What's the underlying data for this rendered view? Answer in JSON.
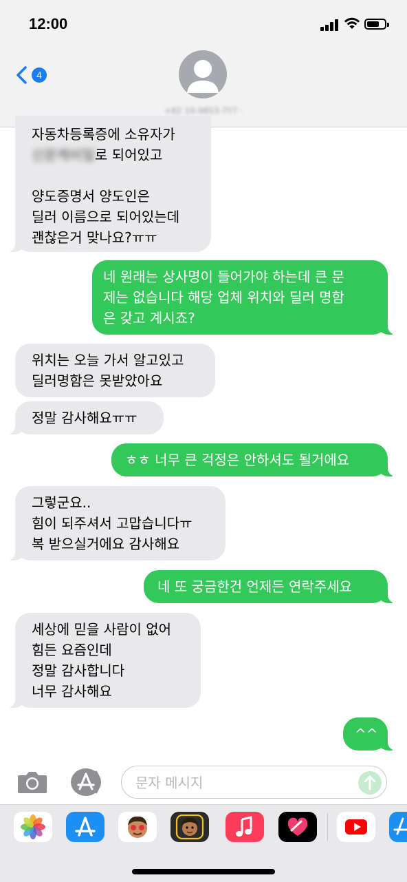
{
  "status": {
    "time": "12:00"
  },
  "header": {
    "back_badge": "4",
    "contact": "+82 10-9853-7Y7 ·"
  },
  "messages": [
    {
      "dir": "received",
      "lines": [
        "자동차등록증에 소유자가",
        "로 되어있고",
        "",
        "양도증명서 양도인은",
        "딜러 이름으로 되어있는데",
        "괜찮은거 맞나요?ㅠㅠ"
      ],
      "redacted": "신문케비밀"
    },
    {
      "dir": "sent",
      "lines": [
        "네 원래는 상사명이 들어가야 하는데 큰 문",
        "제는 없습니다 해당 업체 위치와 딜러 명함",
        "은 갖고 계시죠?"
      ]
    },
    {
      "dir": "received",
      "lines": [
        "위치는 오늘 가서 알고있고",
        "딜러명함은 못받았아요"
      ]
    },
    {
      "dir": "received",
      "lines": [
        "정말 감사해요ㅠㅠ"
      ]
    },
    {
      "dir": "sent",
      "lines": [
        "ㅎㅎ 너무 큰 걱정은 안하셔도 될거에요"
      ]
    },
    {
      "dir": "received",
      "lines": [
        "그렇군요..",
        "힘이 되주셔서 고맙습니다ㅠ",
        "복 받으실거에요 감사해요"
      ]
    },
    {
      "dir": "sent",
      "lines": [
        "네 또 궁금한건 언제든 연락주세요"
      ]
    },
    {
      "dir": "received",
      "lines": [
        "세상에 믿을 사람이 없어",
        "힘든 요즘인데",
        "정말 감사합니다",
        "너무 감사해요"
      ]
    },
    {
      "dir": "sent",
      "lines": [
        "^^"
      ]
    }
  ],
  "input": {
    "placeholder": "문자 메시지"
  },
  "drawer": {
    "apps": [
      "photos-icon",
      "app-store-icon",
      "memoji-icon",
      "memoji-stickers-icon",
      "music-icon",
      "digital-touch-icon",
      "youtube-icon",
      "app-store-partial-icon"
    ]
  },
  "colors": {
    "sent_bubble": "#34c759",
    "received_bubble": "#e9e9eb",
    "badge": "#1a7cf5"
  }
}
